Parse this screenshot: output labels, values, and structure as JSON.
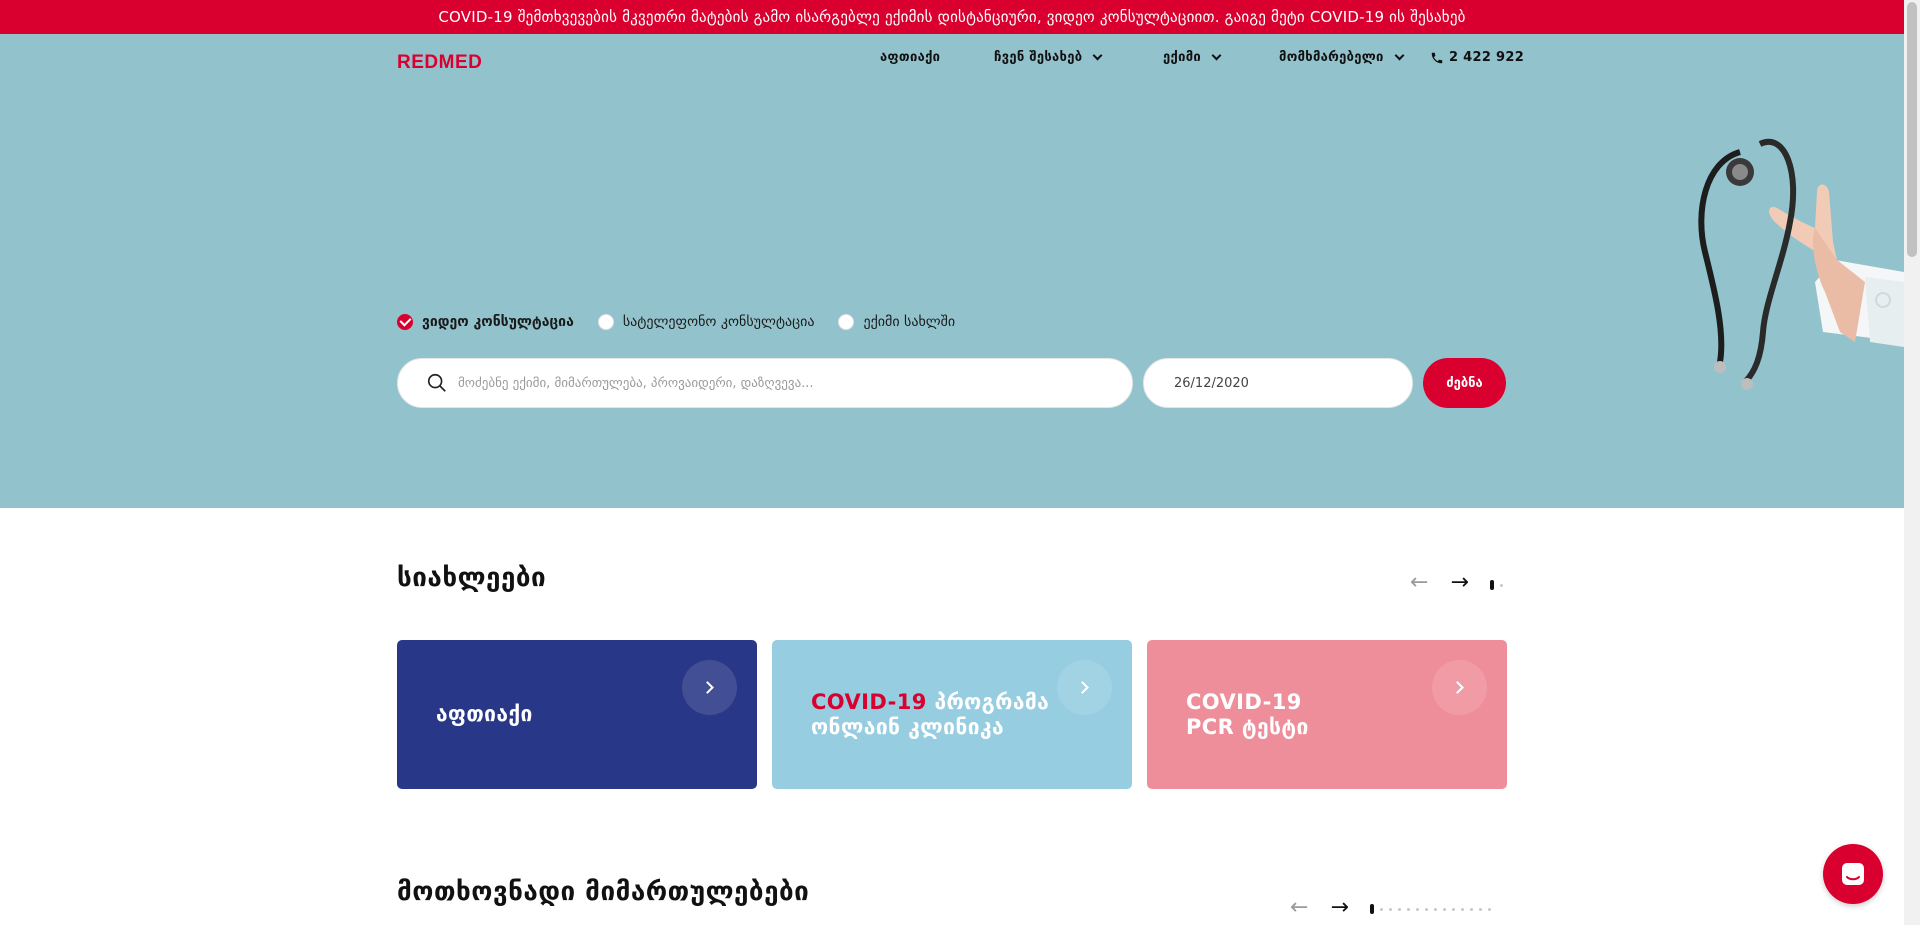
{
  "announcement": "COVID-19 შემთხვევების მკვეთრი მატების გამო ისარგებლე ექიმის დისტანციური, ვიდეო კონსულტაციით. გაიგე მეტი COVID-19 ის შესახებ",
  "header": {
    "logo": "REDMED",
    "nav": [
      {
        "label": "აფთიაქი"
      },
      {
        "label": "ჩვენ შესახებ"
      },
      {
        "label": "ექიმი"
      },
      {
        "label": "მომხმარებელი"
      }
    ],
    "phone": "2 422 922"
  },
  "consult_types": [
    {
      "label": "ვიდეო კონსულტაცია",
      "selected": true
    },
    {
      "label": "სატელეფონო კონსულტაცია",
      "selected": false
    },
    {
      "label": "ექიმი სახლში",
      "selected": false
    }
  ],
  "search": {
    "placeholder": "მოძებნე ექიმი, მიმართულება, პროვაიდერი, დაზღვევა...",
    "date": "26/12/2020",
    "button": "ძებნა"
  },
  "news": {
    "title": "სიახლეები",
    "cards": [
      {
        "line1": "აფთიაქი",
        "color": "#283787"
      },
      {
        "highlight": "COVID-19",
        "line1": " პროგრამა",
        "line2": "ონლაინ კლინიკა",
        "color": "#96cde1"
      },
      {
        "line1": "COVID-19",
        "line2": "PCR ტესტი",
        "color": "#ef8e9b"
      }
    ]
  },
  "directions": {
    "title": "მოთხოვნადი მიმართულებები"
  },
  "colors": {
    "brand": "#d9002f",
    "hero": "#92c3cd"
  },
  "icons": [
    "search-icon",
    "phone-icon",
    "chevron-down-icon",
    "arrow-left-icon",
    "arrow-right-icon",
    "chat-icon",
    "stethoscope-image"
  ]
}
